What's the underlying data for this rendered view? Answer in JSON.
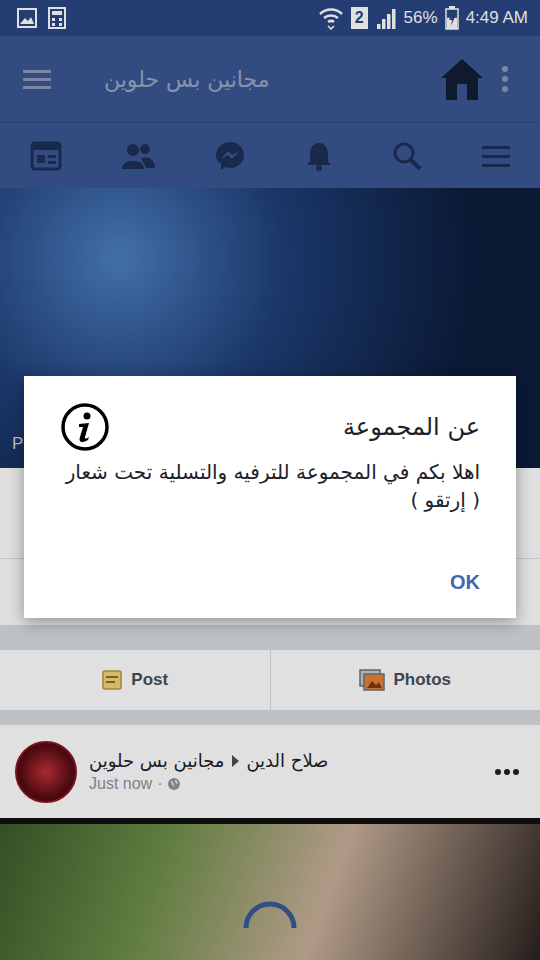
{
  "status_bar": {
    "sim_slot": "2",
    "battery": "56%",
    "battery_level": 0.56,
    "charging": true,
    "signal_level": 1,
    "time": "4:49 AM"
  },
  "app_bar": {
    "title": "مجانين بس حلوين"
  },
  "cover": {
    "privacy_label": "P"
  },
  "composer": {
    "actions": [
      {
        "label": "Post",
        "kind": "post"
      },
      {
        "label": "Photos",
        "kind": "photos"
      }
    ]
  },
  "posts": [
    {
      "group": "مجانين بس حلوين",
      "author": "صلاح الدين",
      "time": "Just now",
      "separator": "·",
      "loading": true
    }
  ],
  "dialog": {
    "title": "عن المجموعة",
    "message": "اهلا بكم في المجموعة للترفيه والتسلية تحت شعار ( إرتقو )",
    "buttons": [
      "OK"
    ]
  }
}
